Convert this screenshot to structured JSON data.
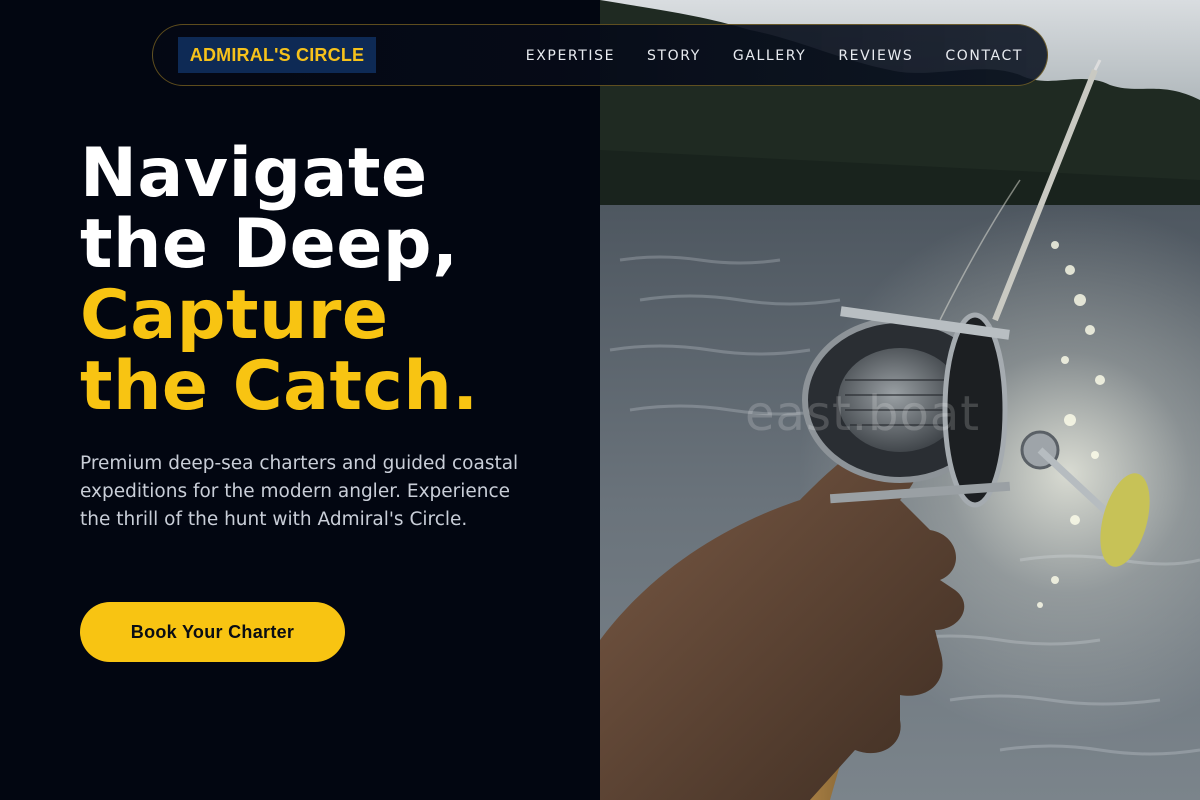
{
  "brand": {
    "logo_text": "ADMIRAL'S CIRCLE"
  },
  "nav": {
    "links": [
      {
        "label": "EXPERTISE"
      },
      {
        "label": "STORY"
      },
      {
        "label": "GALLERY"
      },
      {
        "label": "REVIEWS"
      },
      {
        "label": "CONTACT"
      }
    ]
  },
  "hero": {
    "headline_line1": "Navigate",
    "headline_line2": "the Deep,",
    "headline_line3": "Capture",
    "headline_line4": "the Catch.",
    "subtitle": "Premium deep-sea charters and guided coastal expeditions for the modern angler. Experience the thrill of the hunt with Admiral's Circle.",
    "cta_label": "Book Your Charter"
  },
  "photo": {
    "description_icon": "fishing-reel-photo",
    "watermark": "east.boat"
  },
  "colors": {
    "background": "#020611",
    "accent_gold": "#f8c412",
    "logo_bg": "#0e2a55",
    "text_muted": "#c9ced8"
  }
}
